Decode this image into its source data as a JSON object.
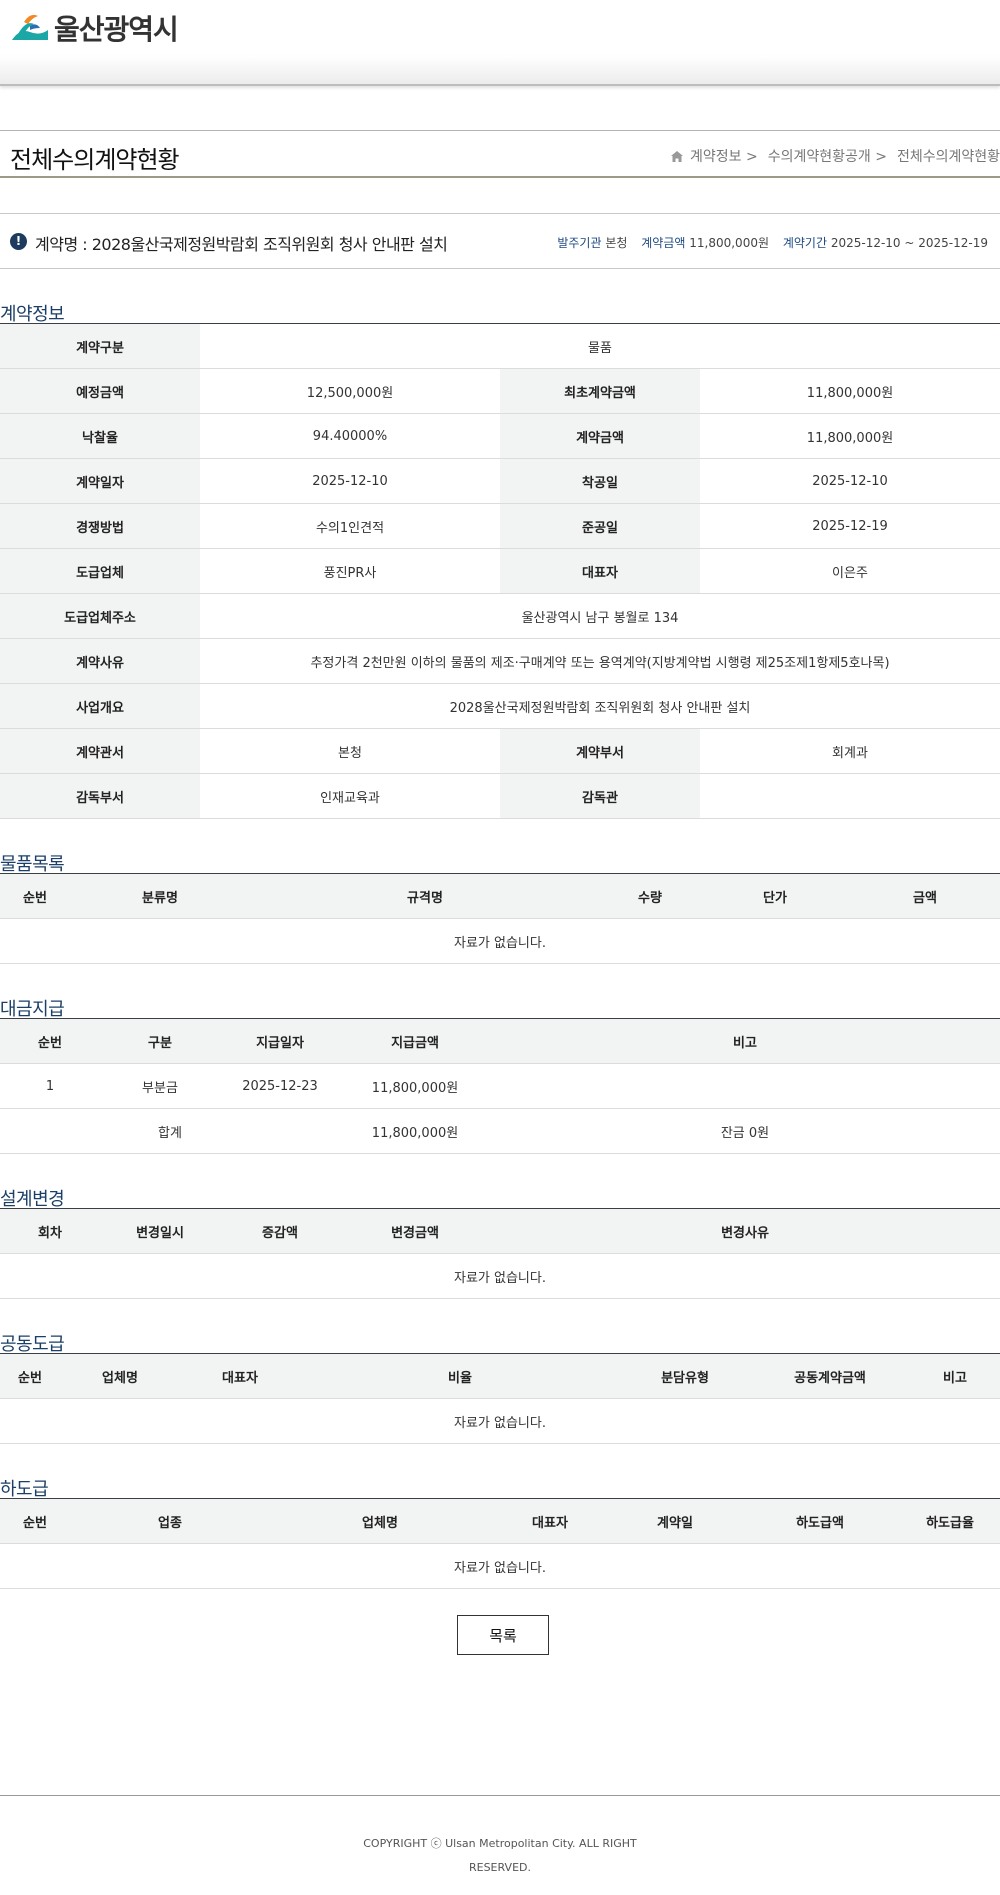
{
  "header": {
    "logo_text": "울산광역시"
  },
  "title_bar": {
    "page_title": "전체수의계약현황",
    "breadcrumb": [
      "계약정보 >",
      "수의계약현황공개 >",
      "전체수의계약현황"
    ]
  },
  "summary": {
    "contract_name": "계약명 : 2028울산국제정원박람회 조직위원회 청사 안내판 설치",
    "agency_label": "발주기관",
    "agency": "본청",
    "amount_label": "계약금액",
    "amount": "11,800,000원",
    "period_label": "계약기간",
    "period": "2025-12-10 ~ 2025-12-19"
  },
  "contract_info": {
    "title": "계약정보",
    "category_label": "계약구분",
    "category": "물품",
    "estimated_label": "예정금액",
    "estimated": "12,500,000원",
    "initial_amount_label": "최초계약금액",
    "initial_amount": "11,800,000원",
    "bid_rate_label": "낙찰율",
    "bid_rate": "94.40000%",
    "contract_amount_label": "계약금액",
    "contract_amount": "11,800,000원",
    "contract_date_label": "계약일자",
    "contract_date": "2025-12-10",
    "start_date_label": "착공일",
    "start_date": "2025-12-10",
    "method_label": "경쟁방법",
    "method": "수의1인견적",
    "end_date_label": "준공일",
    "end_date": "2025-12-19",
    "contractor_label": "도급업체",
    "contractor": "풍진PR사",
    "ceo_label": "대표자",
    "ceo": "이은주",
    "address_label": "도급업체주소",
    "address": "울산광역시 남구 봉월로 134",
    "reason_label": "계약사유",
    "reason": "추정가격 2천만원 이하의 물품의 제조·구매계약 또는 용역계약(지방계약법 시행령 제25조제1항제5호나목)",
    "overview_label": "사업개요",
    "overview": "2028울산국제정원박람회 조직위원회 청사 안내판 설치",
    "office_label": "계약관서",
    "office": "본청",
    "dept_label": "계약부서",
    "dept": "회계과",
    "supervise_dept_label": "감독부서",
    "supervise_dept": "인재교육과",
    "supervisor_label": "감독관",
    "supervisor": ""
  },
  "goods": {
    "title": "물품목록",
    "headers": [
      "순번",
      "분류명",
      "규격명",
      "수량",
      "단가",
      "금액"
    ],
    "empty": "자료가 없습니다."
  },
  "payment": {
    "title": "대금지급",
    "headers": [
      "순번",
      "구분",
      "지급일자",
      "지급금액",
      "비고"
    ],
    "row": {
      "no": "1",
      "type": "부분금",
      "date": "2025-12-23",
      "amount": "11,800,000원",
      "note": ""
    },
    "total_label": "합계",
    "total_amount": "11,800,000원",
    "balance": "잔금 0원"
  },
  "design_change": {
    "title": "설계변경",
    "headers": [
      "회차",
      "변경일시",
      "증감액",
      "변경금액",
      "변경사유"
    ],
    "empty": "자료가 없습니다."
  },
  "joint": {
    "title": "공동도급",
    "headers": [
      "순번",
      "업체명",
      "대표자",
      "비율",
      "분담유형",
      "공동계약금액",
      "비고"
    ],
    "empty": "자료가 없습니다."
  },
  "subcontract": {
    "title": "하도급",
    "headers": [
      "순번",
      "업종",
      "업체명",
      "대표자",
      "계약일",
      "하도급액",
      "하도급율"
    ],
    "empty": "자료가 없습니다."
  },
  "list_button": "목록",
  "footer": {
    "copyright": "COPYRIGHT ⓒ Ulsan Metropolitan City. ALL RIGHT RESERVED."
  }
}
